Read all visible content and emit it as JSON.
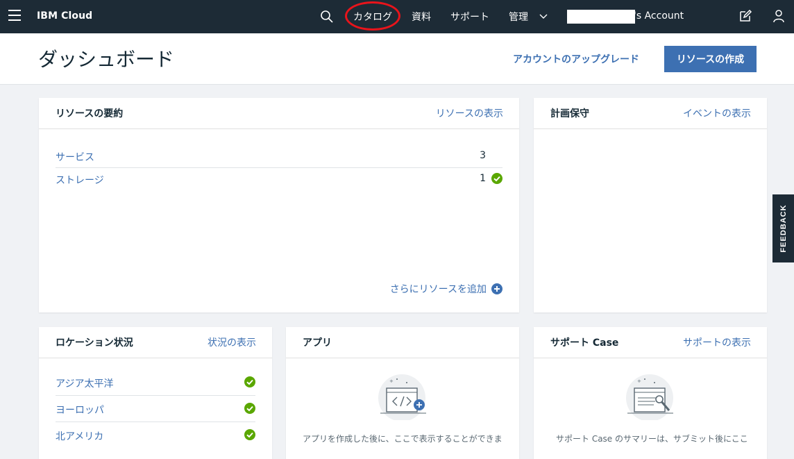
{
  "nav": {
    "brand": "IBM Cloud",
    "catalog": "カタログ",
    "docs": "資料",
    "support": "サポート",
    "manage": "管理",
    "account": "'s Account"
  },
  "header": {
    "title": "ダッシュボード",
    "upgrade": "アカウントのアップグレード",
    "create": "リソースの作成"
  },
  "resources": {
    "title": "リソースの要約",
    "link": "リソースの表示",
    "rows": [
      {
        "label": "サービス",
        "count": "3"
      },
      {
        "label": "ストレージ",
        "count": "1"
      }
    ],
    "add_more": "さらにリソースを追加"
  },
  "maintenance": {
    "title": "計画保守",
    "link": "イベントの表示"
  },
  "locations": {
    "title": "ロケーション状況",
    "link": "状況の表示",
    "rows": [
      {
        "label": "アジア太平洋"
      },
      {
        "label": "ヨーロッパ"
      },
      {
        "label": "北アメリカ"
      }
    ]
  },
  "apps": {
    "title": "アプリ",
    "empty": "アプリを作成した後に、ここで表示することができま"
  },
  "support_cases": {
    "title": "サポート Case",
    "link": "サポートの表示",
    "empty": "サポート Case のサマリーは、サブミット後にここ"
  },
  "feedback": "FEEDBACK",
  "colors": {
    "nav_bg": "#1d2b36",
    "link": "#3d70b2",
    "primary_button": "#3d70b2",
    "success": "#5aa700",
    "highlight": "#e8141b"
  }
}
